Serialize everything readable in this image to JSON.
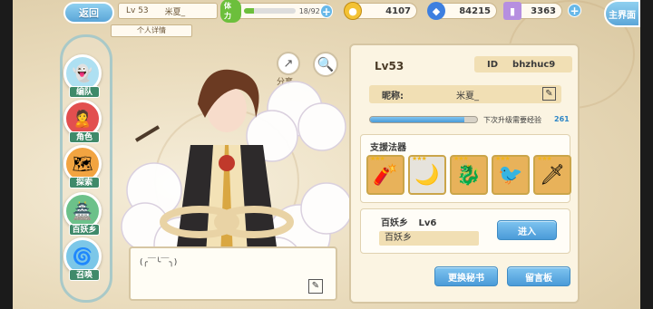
{
  "topbar": {
    "back_label": "返回",
    "level_label": "Lv 53",
    "player_name": "米夏_",
    "stamina_label": "体力",
    "stamina_value": "18/92",
    "stamina_fraction": 0.2,
    "gold": "4107",
    "gems": "84215",
    "tickets": "3363",
    "main_label": "主界面"
  },
  "tab": {
    "label": "个人详情"
  },
  "nav": {
    "items": [
      {
        "label": "编队",
        "icon": "ghost-icon"
      },
      {
        "label": "角色",
        "icon": "character-icon"
      },
      {
        "label": "探索",
        "icon": "explore-icon"
      },
      {
        "label": "百妖乡",
        "icon": "village-icon"
      },
      {
        "label": "召唤",
        "icon": "summon-icon"
      }
    ]
  },
  "center": {
    "share_label": "分享",
    "message": "(╭￣╰￣╮)"
  },
  "panel": {
    "level": "Lv53",
    "id_label": "ID",
    "id_value": "bhzhuc9",
    "nickname_label": "昵称:",
    "nickname_value": "米夏_",
    "exp_fraction": 0.88,
    "exp_label": "下次升级需要经验",
    "exp_value": "261",
    "support_title": "支援法器",
    "items": [
      {
        "icon": "red-tool-icon",
        "stars": "★★★",
        "bg": "#e8b25a"
      },
      {
        "icon": "crescent-blade-icon",
        "stars": "★★★",
        "bg": "#e6e3dc"
      },
      {
        "icon": "blue-dragon-icon",
        "stars": "★★★",
        "bg": "#e8b25a"
      },
      {
        "icon": "yellow-bird-icon",
        "stars": "★★★",
        "bg": "#e8b25a"
      },
      {
        "icon": "star-sword-icon",
        "stars": "★★★",
        "bg": "#e8b25a"
      }
    ],
    "village_title": "百妖乡",
    "village_level": "Lv6",
    "village_name": "百妖乡",
    "enter_label": "进入",
    "change_secretary_label": "更换秘书",
    "message_board_label": "留言板"
  }
}
